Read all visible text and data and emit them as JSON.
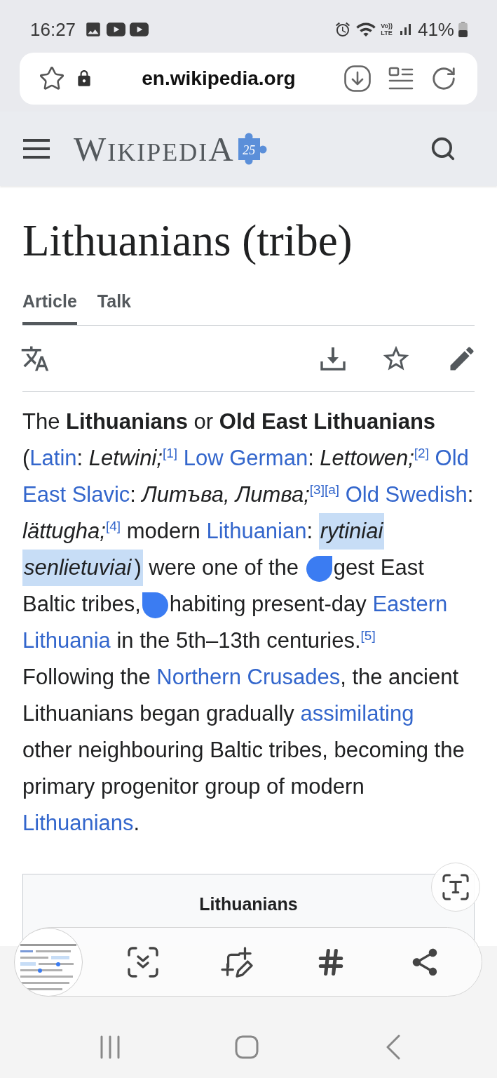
{
  "status_bar": {
    "time": "16:27",
    "volte": [
      "Vo))",
      "LTE"
    ],
    "battery_percent": "41%"
  },
  "address_bar": {
    "url": "en.wikipedia.org"
  },
  "site_header": {
    "wordmark": "WIKIPEDIA",
    "badge": "25"
  },
  "page": {
    "title": "Lithuanians (tribe)",
    "tabs": [
      {
        "label": "Article",
        "selected": true
      },
      {
        "label": "Talk",
        "selected": false
      }
    ],
    "intro": {
      "lines": [
        [
          {
            "kind": "text",
            "text": "The ",
            "selected": false
          },
          {
            "kind": "bold",
            "text": "Lithuanians",
            "selected": false
          },
          {
            "kind": "text",
            "text": " or ",
            "selected": false
          },
          {
            "kind": "bold",
            "text": "Old East Lithuanians",
            "selected": false
          }
        ],
        [
          {
            "kind": "text",
            "text": "(",
            "selected": false
          },
          {
            "kind": "link",
            "text": "Latin",
            "selected": false
          },
          {
            "kind": "text",
            "text": ": ",
            "selected": false
          },
          {
            "kind": "italic",
            "text": "Letwini;",
            "selected": false
          },
          {
            "kind": "cite",
            "text": "[1]",
            "selected": false
          },
          {
            "kind": "space"
          },
          {
            "kind": "link",
            "text": "Low German",
            "selected": false
          },
          {
            "kind": "text",
            "text": ": ",
            "selected": false
          },
          {
            "kind": "italic",
            "text": "Lettowen;",
            "selected": false
          },
          {
            "kind": "cite",
            "text": "[2]",
            "selected": false
          },
          {
            "kind": "space"
          },
          {
            "kind": "link",
            "text": "Old",
            "selected": false
          }
        ],
        [
          {
            "kind": "link",
            "text": "East Slavic",
            "selected": false
          },
          {
            "kind": "text",
            "text": ": ",
            "selected": false
          },
          {
            "kind": "italic",
            "text": "Литъва, Литва;",
            "selected": false
          },
          {
            "kind": "cite",
            "text": "[3]",
            "selected": false
          },
          {
            "kind": "cite",
            "text": "[a]",
            "selected": false
          },
          {
            "kind": "space"
          },
          {
            "kind": "link",
            "text": "Old Swedish",
            "selected": false
          },
          {
            "kind": "text",
            "text": ":",
            "selected": false
          }
        ],
        [
          {
            "kind": "italic",
            "text": "lättugha;",
            "selected": false
          },
          {
            "kind": "cite",
            "text": "[4]",
            "selected": false
          },
          {
            "kind": "text",
            "text": " modern ",
            "selected": false
          },
          {
            "kind": "link",
            "text": "Lithuanian",
            "selected": false
          },
          {
            "kind": "text",
            "text": ": ",
            "selected": false
          },
          {
            "kind": "italic",
            "text": "rytiniai",
            "selected": true
          }
        ],
        [
          {
            "kind": "italic",
            "text": "senlietuviai",
            "selected": true
          },
          {
            "kind": "text",
            "text": ")",
            "selected": true
          },
          {
            "kind": "text",
            "text": " were one of the ",
            "selected": false
          },
          {
            "kind": "handle_start"
          },
          {
            "kind": "text",
            "text": "gest East",
            "selected": false
          }
        ],
        [
          {
            "kind": "text",
            "text": "Baltic tribes,",
            "selected": false
          },
          {
            "kind": "handle_end"
          },
          {
            "kind": "text",
            "text": "habiting present-day ",
            "selected": false
          },
          {
            "kind": "link",
            "text": "Eastern",
            "selected": false
          }
        ],
        [
          {
            "kind": "link",
            "text": "Lithuania",
            "selected": false
          },
          {
            "kind": "text",
            "text": " in the 5th–13th centuries.",
            "selected": false
          },
          {
            "kind": "cite",
            "text": "[5]",
            "selected": false
          }
        ],
        [
          {
            "kind": "text",
            "text": "Following the ",
            "selected": false
          },
          {
            "kind": "link",
            "text": "Northern Crusades",
            "selected": false
          },
          {
            "kind": "text",
            "text": ", the ancient",
            "selected": false
          }
        ],
        [
          {
            "kind": "text",
            "text": "Lithuanians began gradually ",
            "selected": false
          },
          {
            "kind": "link",
            "text": "assimilating",
            "selected": false
          }
        ],
        [
          {
            "kind": "text",
            "text": "other neighbouring Baltic tribes, becoming the",
            "selected": false
          }
        ],
        [
          {
            "kind": "text",
            "text": "primary progenitor group of modern",
            "selected": false
          }
        ],
        [
          {
            "kind": "link",
            "text": "Lithuanians",
            "selected": false
          },
          {
            "kind": "text",
            "text": ".",
            "selected": false
          }
        ]
      ]
    },
    "infobox": {
      "title": "Lithuanians"
    }
  }
}
